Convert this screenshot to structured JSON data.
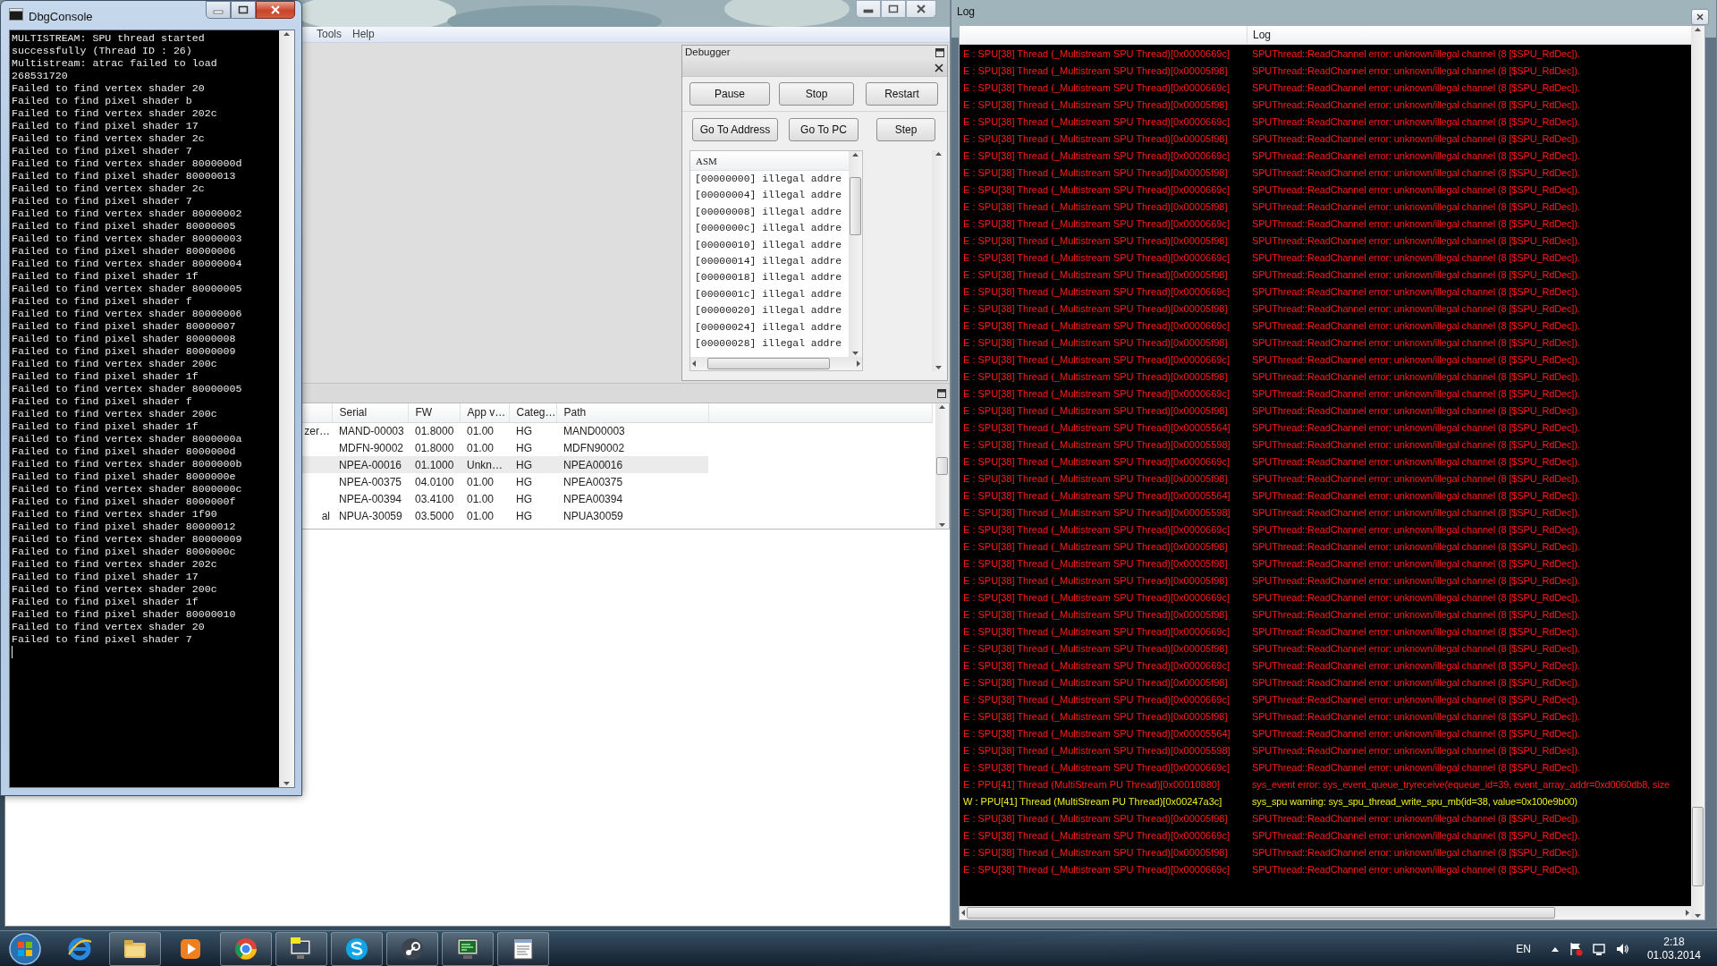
{
  "console_window": {
    "title": "DbgConsole",
    "lines": [
      "MULTISTREAM: SPU thread started",
      "successfully (Thread ID : 26)",
      "Multistream: atrac failed to load",
      "268531720",
      "Failed to find vertex shader 20",
      "Failed to find pixel shader b",
      "Failed to find vertex shader 202c",
      "Failed to find pixel shader 17",
      "Failed to find vertex shader 2c",
      "Failed to find pixel shader 7",
      "Failed to find vertex shader 8000000d",
      "Failed to find pixel shader 80000013",
      "Failed to find vertex shader 2c",
      "Failed to find pixel shader 7",
      "Failed to find vertex shader 80000002",
      "Failed to find pixel shader 80000005",
      "Failed to find vertex shader 80000003",
      "Failed to find pixel shader 80000006",
      "Failed to find vertex shader 80000004",
      "Failed to find pixel shader 1f",
      "Failed to find vertex shader 80000005",
      "Failed to find pixel shader f",
      "Failed to find vertex shader 80000006",
      "Failed to find pixel shader 80000007",
      "Failed to find pixel shader 80000008",
      "Failed to find pixel shader 80000009",
      "Failed to find vertex shader 200c",
      "Failed to find pixel shader 1f",
      "Failed to find vertex shader 80000005",
      "Failed to find pixel shader f",
      "Failed to find vertex shader 200c",
      "Failed to find pixel shader 1f",
      "Failed to find vertex shader 8000000a",
      "Failed to find pixel shader 8000000d",
      "Failed to find vertex shader 8000000b",
      "Failed to find pixel shader 8000000e",
      "Failed to find vertex shader 8000000c",
      "Failed to find pixel shader 8000000f",
      "Failed to find vertex shader 1f90",
      "Failed to find pixel shader 80000012",
      "Failed to find vertex shader 80000009",
      "Failed to find pixel shader 8000000c",
      "Failed to find vertex shader 202c",
      "Failed to find pixel shader 17",
      "Failed to find vertex shader 200c",
      "Failed to find pixel shader 1f",
      "Failed to find pixel shader 80000010",
      "Failed to find vertex shader 20",
      "Failed to find pixel shader 7"
    ]
  },
  "main_window": {
    "menu": [
      {
        "label": "Tools"
      },
      {
        "label": "Help"
      }
    ],
    "debugger": {
      "title": "Debugger",
      "control_buttons": [
        {
          "label": "Pause"
        },
        {
          "label": "Stop"
        },
        {
          "label": "Restart"
        }
      ],
      "nav_buttons": [
        {
          "label": "Go To Address"
        },
        {
          "label": "Go To PC"
        },
        {
          "label": "Step"
        }
      ],
      "asm": {
        "header": "ASM",
        "rows": [
          "[00000000] illegal addre",
          "[00000004] illegal addre",
          "[00000008] illegal addre",
          "[0000000c] illegal addre",
          "[00000010] illegal addre",
          "[00000014] illegal addre",
          "[00000018] illegal addre",
          "[0000001c] illegal addre",
          "[00000020] illegal addre",
          "[00000024] illegal addre",
          "[00000028] illegal addre"
        ]
      }
    },
    "game_list": {
      "columns": [
        "Serial",
        "FW",
        "App v…",
        "Categ…",
        "Path"
      ],
      "rows": [
        {
          "column_1": "zer…",
          "serial": "MAND-00003",
          "fw": "01.8000",
          "app_v": "01.00",
          "categ": "HG",
          "path": "MAND00003",
          "selected": false
        },
        {
          "serial": "MDFN-90002",
          "fw": "01.8000",
          "app_v": "01.00",
          "categ": "HG",
          "path": "MDFN90002",
          "selected": false
        },
        {
          "serial": "NPEA-00016",
          "fw": "01.1000",
          "app_v": "Unkn…",
          "categ": "HG",
          "path": "NPEA00016",
          "selected": true
        },
        {
          "serial": "NPEA-00375",
          "fw": "04.0100",
          "app_v": "01.00",
          "categ": "HG",
          "path": "NPEA00375",
          "selected": false
        },
        {
          "serial": "NPEA-00394",
          "fw": "03.4100",
          "app_v": "01.00",
          "categ": "HG",
          "path": "NPEA00394",
          "selected": false
        },
        {
          "column_1": "al",
          "serial": "NPUA-30059",
          "fw": "03.5000",
          "app_v": "01.00",
          "categ": "HG",
          "path": "NPUA30059",
          "selected": false
        }
      ]
    }
  },
  "log_window": {
    "title": "Log",
    "column": "Log",
    "entries": [
      {
        "kind": "error",
        "source": "E : SPU[38] Thread (_Multistream SPU Thread)[0x0000669c]",
        "message": "SPUThread::ReadChannel error: unknown/illegal channel (8 [$SPU_RdDec])."
      },
      {
        "kind": "error",
        "source": "E : SPU[38] Thread (_Multistream SPU Thread)[0x00005f98]",
        "message": "SPUThread::ReadChannel error: unknown/illegal channel (8 [$SPU_RdDec])."
      },
      {
        "kind": "error",
        "source": "E : SPU[38] Thread (_Multistream SPU Thread)[0x0000669c]",
        "message": "SPUThread::ReadChannel error: unknown/illegal channel (8 [$SPU_RdDec])."
      },
      {
        "kind": "error",
        "source": "E : SPU[38] Thread (_Multistream SPU Thread)[0x00005f98]",
        "message": "SPUThread::ReadChannel error: unknown/illegal channel (8 [$SPU_RdDec])."
      },
      {
        "kind": "error",
        "source": "E : SPU[38] Thread (_Multistream SPU Thread)[0x0000669c]",
        "message": "SPUThread::ReadChannel error: unknown/illegal channel (8 [$SPU_RdDec])."
      },
      {
        "kind": "error",
        "source": "E : SPU[38] Thread (_Multistream SPU Thread)[0x00005f98]",
        "message": "SPUThread::ReadChannel error: unknown/illegal channel (8 [$SPU_RdDec])."
      },
      {
        "kind": "error",
        "source": "E : SPU[38] Thread (_Multistream SPU Thread)[0x0000669c]",
        "message": "SPUThread::ReadChannel error: unknown/illegal channel (8 [$SPU_RdDec])."
      },
      {
        "kind": "error",
        "source": "E : SPU[38] Thread (_Multistream SPU Thread)[0x00005f98]",
        "message": "SPUThread::ReadChannel error: unknown/illegal channel (8 [$SPU_RdDec])."
      },
      {
        "kind": "error",
        "source": "E : SPU[38] Thread (_Multistream SPU Thread)[0x0000669c]",
        "message": "SPUThread::ReadChannel error: unknown/illegal channel (8 [$SPU_RdDec])."
      },
      {
        "kind": "error",
        "source": "E : SPU[38] Thread (_Multistream SPU Thread)[0x00005f98]",
        "message": "SPUThread::ReadChannel error: unknown/illegal channel (8 [$SPU_RdDec])."
      },
      {
        "kind": "error",
        "source": "E : SPU[38] Thread (_Multistream SPU Thread)[0x0000669c]",
        "message": "SPUThread::ReadChannel error: unknown/illegal channel (8 [$SPU_RdDec])."
      },
      {
        "kind": "error",
        "source": "E : SPU[38] Thread (_Multistream SPU Thread)[0x00005f98]",
        "message": "SPUThread::ReadChannel error: unknown/illegal channel (8 [$SPU_RdDec])."
      },
      {
        "kind": "error",
        "source": "E : SPU[38] Thread (_Multistream SPU Thread)[0x0000669c]",
        "message": "SPUThread::ReadChannel error: unknown/illegal channel (8 [$SPU_RdDec])."
      },
      {
        "kind": "error",
        "source": "E : SPU[38] Thread (_Multistream SPU Thread)[0x00005f98]",
        "message": "SPUThread::ReadChannel error: unknown/illegal channel (8 [$SPU_RdDec])."
      },
      {
        "kind": "error",
        "source": "E : SPU[38] Thread (_Multistream SPU Thread)[0x0000669c]",
        "message": "SPUThread::ReadChannel error: unknown/illegal channel (8 [$SPU_RdDec])."
      },
      {
        "kind": "error",
        "source": "E : SPU[38] Thread (_Multistream SPU Thread)[0x00005f98]",
        "message": "SPUThread::ReadChannel error: unknown/illegal channel (8 [$SPU_RdDec])."
      },
      {
        "kind": "error",
        "source": "E : SPU[38] Thread (_Multistream SPU Thread)[0x0000669c]",
        "message": "SPUThread::ReadChannel error: unknown/illegal channel (8 [$SPU_RdDec])."
      },
      {
        "kind": "error",
        "source": "E : SPU[38] Thread (_Multistream SPU Thread)[0x00005f98]",
        "message": "SPUThread::ReadChannel error: unknown/illegal channel (8 [$SPU_RdDec])."
      },
      {
        "kind": "error",
        "source": "E : SPU[38] Thread (_Multistream SPU Thread)[0x0000669c]",
        "message": "SPUThread::ReadChannel error: unknown/illegal channel (8 [$SPU_RdDec])."
      },
      {
        "kind": "error",
        "source": "E : SPU[38] Thread (_Multistream SPU Thread)[0x00005f98]",
        "message": "SPUThread::ReadChannel error: unknown/illegal channel (8 [$SPU_RdDec])."
      },
      {
        "kind": "error",
        "source": "E : SPU[38] Thread (_Multistream SPU Thread)[0x0000669c]",
        "message": "SPUThread::ReadChannel error: unknown/illegal channel (8 [$SPU_RdDec])."
      },
      {
        "kind": "error",
        "source": "E : SPU[38] Thread (_Multistream SPU Thread)[0x00005f98]",
        "message": "SPUThread::ReadChannel error: unknown/illegal channel (8 [$SPU_RdDec])."
      },
      {
        "kind": "error",
        "source": "E : SPU[38] Thread (_Multistream SPU Thread)[0x00005564]",
        "message": "SPUThread::ReadChannel error: unknown/illegal channel (8 [$SPU_RdDec])."
      },
      {
        "kind": "error",
        "source": "E : SPU[38] Thread (_Multistream SPU Thread)[0x00005598]",
        "message": "SPUThread::ReadChannel error: unknown/illegal channel (8 [$SPU_RdDec])."
      },
      {
        "kind": "error",
        "source": "E : SPU[38] Thread (_Multistream SPU Thread)[0x0000669c]",
        "message": "SPUThread::ReadChannel error: unknown/illegal channel (8 [$SPU_RdDec])."
      },
      {
        "kind": "error",
        "source": "E : SPU[38] Thread (_Multistream SPU Thread)[0x00005f98]",
        "message": "SPUThread::ReadChannel error: unknown/illegal channel (8 [$SPU_RdDec])."
      },
      {
        "kind": "error",
        "source": "E : SPU[38] Thread (_Multistream SPU Thread)[0x00005564]",
        "message": "SPUThread::ReadChannel error: unknown/illegal channel (8 [$SPU_RdDec])."
      },
      {
        "kind": "error",
        "source": "E : SPU[38] Thread (_Multistream SPU Thread)[0x00005598]",
        "message": "SPUThread::ReadChannel error: unknown/illegal channel (8 [$SPU_RdDec])."
      },
      {
        "kind": "error",
        "source": "E : SPU[38] Thread (_Multistream SPU Thread)[0x0000669c]",
        "message": "SPUThread::ReadChannel error: unknown/illegal channel (8 [$SPU_RdDec])."
      },
      {
        "kind": "error",
        "source": "E : SPU[38] Thread (_Multistream SPU Thread)[0x00005f98]",
        "message": "SPUThread::ReadChannel error: unknown/illegal channel (8 [$SPU_RdDec])."
      },
      {
        "kind": "error",
        "source": "E : SPU[38] Thread (_Multistream SPU Thread)[0x00005f98]",
        "message": "SPUThread::ReadChannel error: unknown/illegal channel (8 [$SPU_RdDec])."
      },
      {
        "kind": "error",
        "source": "E : SPU[38] Thread (_Multistream SPU Thread)[0x00005f98]",
        "message": "SPUThread::ReadChannel error: unknown/illegal channel (8 [$SPU_RdDec])."
      },
      {
        "kind": "error",
        "source": "E : SPU[38] Thread (_Multistream SPU Thread)[0x0000669c]",
        "message": "SPUThread::ReadChannel error: unknown/illegal channel (8 [$SPU_RdDec])."
      },
      {
        "kind": "error",
        "source": "E : SPU[38] Thread (_Multistream SPU Thread)[0x00005f98]",
        "message": "SPUThread::ReadChannel error: unknown/illegal channel (8 [$SPU_RdDec])."
      },
      {
        "kind": "error",
        "source": "E : SPU[38] Thread (_Multistream SPU Thread)[0x0000669c]",
        "message": "SPUThread::ReadChannel error: unknown/illegal channel (8 [$SPU_RdDec])."
      },
      {
        "kind": "error",
        "source": "E : SPU[38] Thread (_Multistream SPU Thread)[0x00005f98]",
        "message": "SPUThread::ReadChannel error: unknown/illegal channel (8 [$SPU_RdDec])."
      },
      {
        "kind": "error",
        "source": "E : SPU[38] Thread (_Multistream SPU Thread)[0x0000669c]",
        "message": "SPUThread::ReadChannel error: unknown/illegal channel (8 [$SPU_RdDec])."
      },
      {
        "kind": "error",
        "source": "E : SPU[38] Thread (_Multistream SPU Thread)[0x00005f98]",
        "message": "SPUThread::ReadChannel error: unknown/illegal channel (8 [$SPU_RdDec])."
      },
      {
        "kind": "error",
        "source": "E : SPU[38] Thread (_Multistream SPU Thread)[0x0000669c]",
        "message": "SPUThread::ReadChannel error: unknown/illegal channel (8 [$SPU_RdDec])."
      },
      {
        "kind": "error",
        "source": "E : SPU[38] Thread (_Multistream SPU Thread)[0x00005f98]",
        "message": "SPUThread::ReadChannel error: unknown/illegal channel (8 [$SPU_RdDec])."
      },
      {
        "kind": "error",
        "source": "E : SPU[38] Thread (_Multistream SPU Thread)[0x00005564]",
        "message": "SPUThread::ReadChannel error: unknown/illegal channel (8 [$SPU_RdDec])."
      },
      {
        "kind": "error",
        "source": "E : SPU[38] Thread (_Multistream SPU Thread)[0x00005598]",
        "message": "SPUThread::ReadChannel error: unknown/illegal channel (8 [$SPU_RdDec])."
      },
      {
        "kind": "error",
        "source": "E : SPU[38] Thread (_Multistream SPU Thread)[0x0000669c]",
        "message": "SPUThread::ReadChannel error: unknown/illegal channel (8 [$SPU_RdDec])."
      },
      {
        "kind": "error",
        "source": "E : PPU[41] Thread (MultiStream PU Thread)[0x00010880]",
        "message": "sys_event error: sys_event_queue_tryreceive(equeue_id=39, event_array_addr=0xd0060db8, size"
      },
      {
        "kind": "warning",
        "source": "W : PPU[41] Thread (MultiStream PU Thread)[0x00247a3c]",
        "message": "sys_spu warning: sys_spu_thread_write_spu_mb(id=38, value=0x100e9b00)"
      },
      {
        "kind": "error",
        "source": "E : SPU[38] Thread (_Multistream SPU Thread)[0x00005f98]",
        "message": "SPUThread::ReadChannel error: unknown/illegal channel (8 [$SPU_RdDec])."
      },
      {
        "kind": "error",
        "source": "E : SPU[38] Thread (_Multistream SPU Thread)[0x0000669c]",
        "message": "SPUThread::ReadChannel error: unknown/illegal channel (8 [$SPU_RdDec])."
      },
      {
        "kind": "error",
        "source": "E : SPU[38] Thread (_Multistream SPU Thread)[0x00005f98]",
        "message": "SPUThread::ReadChannel error: unknown/illegal channel (8 [$SPU_RdDec])."
      },
      {
        "kind": "error",
        "source": "E : SPU[38] Thread (_Multistream SPU Thread)[0x0000669c]",
        "message": "SPUThread::ReadChannel error: unknown/illegal channel (8 [$SPU_RdDec])."
      }
    ]
  },
  "taskbar": {
    "language": "EN",
    "time": "2:18",
    "date": "01.03.2014"
  }
}
